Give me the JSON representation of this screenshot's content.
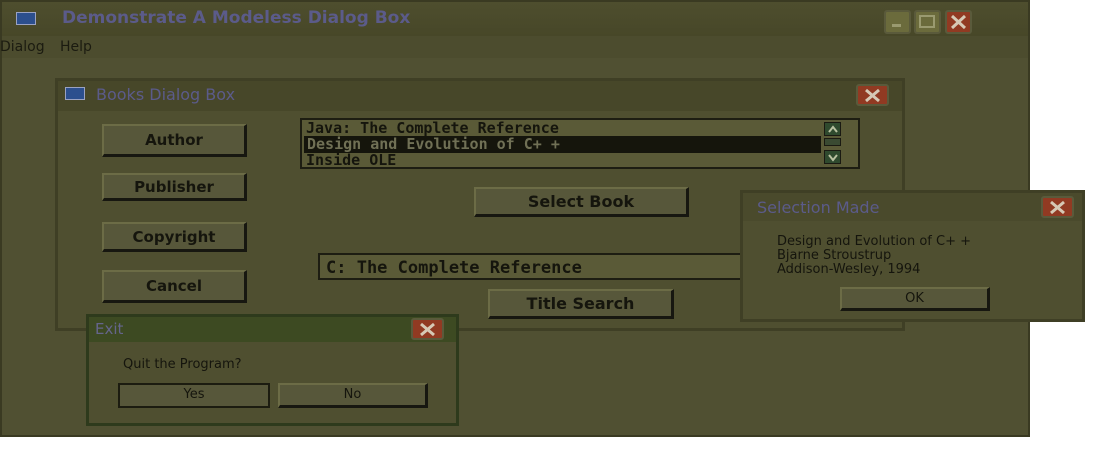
{
  "main_window": {
    "title": "Demonstrate A Modeless Dialog Box",
    "menu": [
      "Dialog",
      "Help"
    ]
  },
  "books_dialog": {
    "title": "Books Dialog Box",
    "buttons": {
      "author": "Author",
      "publisher": "Publisher",
      "copyright": "Copyright",
      "cancel": "Cancel",
      "select_book": "Select Book",
      "title_search": "Title Search"
    },
    "book_list": [
      "Java: The Complete Reference",
      "Design and Evolution of C+ +",
      "Inside OLE"
    ],
    "selected_index": 1,
    "search_field_value": "C: The Complete Reference"
  },
  "selection_dialog": {
    "title": "Selection Made",
    "lines": [
      "Design and Evolution of C+ +",
      "Bjarne Stroustrup",
      "Addison-Wesley, 1994"
    ],
    "ok_label": "OK"
  },
  "exit_dialog": {
    "title": "Exit",
    "message": "Quit the Program?",
    "yes_label": "Yes",
    "no_label": "No"
  },
  "colors": {
    "title_text": "#5b5b8a",
    "window_background": "#505032",
    "close_button": "#913a22",
    "list_selection": "#15150c"
  }
}
